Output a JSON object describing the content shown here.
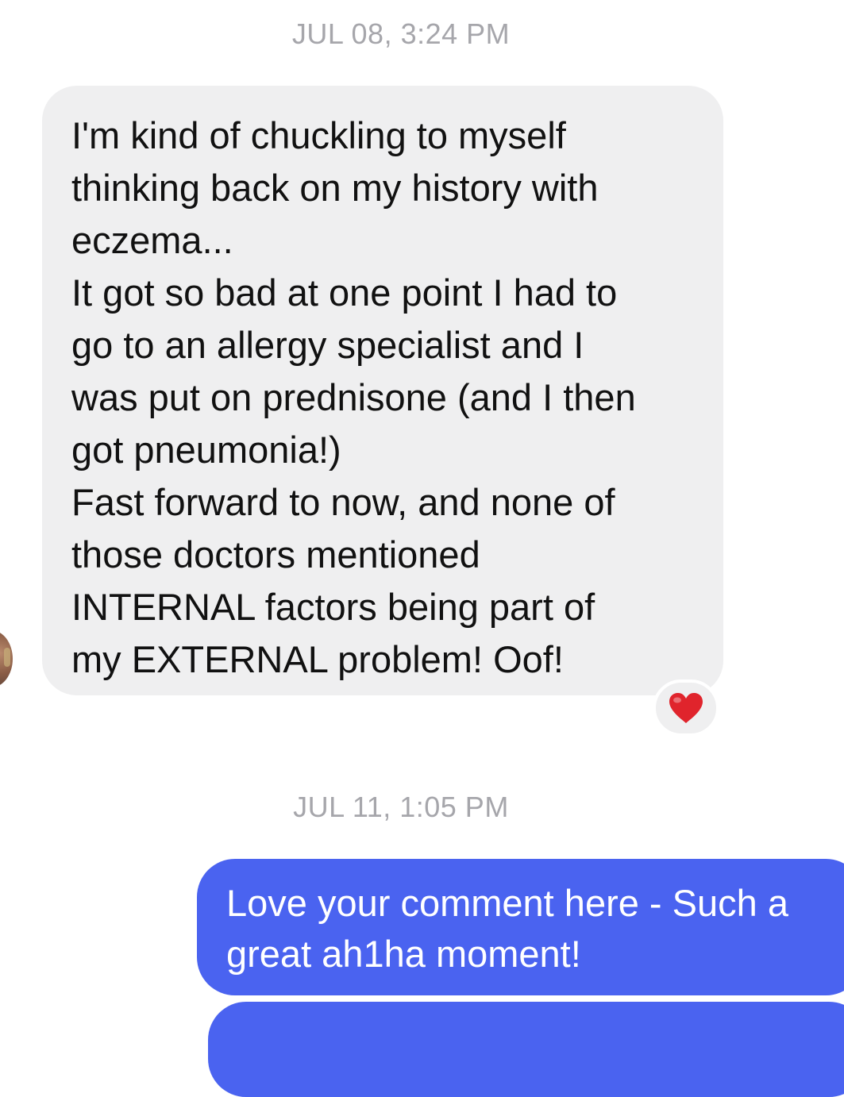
{
  "conversation": {
    "timestamps": [
      "JUL 08, 3:24 PM",
      "JUL 11, 1:05 PM"
    ],
    "incoming_message": {
      "lines": [
        "I'm kind of chuckling to myself",
        "thinking back on my history with",
        "eczema...",
        "It got so bad at one point I had to",
        "go to an allergy specialist and I",
        "was put on prednisone (and I then",
        "got pneumonia!)",
        "Fast forward to now, and none of",
        "those doctors mentioned",
        "INTERNAL factors being part of",
        "my EXTERNAL problem! Oof!"
      ],
      "reaction_icon": "heart-icon",
      "reaction_color": "#e0242c"
    },
    "outgoing_message": {
      "lines": [
        "Love your comment here - Such a",
        "great ah1ha moment!"
      ],
      "bubble_color": "#4a63f0"
    }
  }
}
